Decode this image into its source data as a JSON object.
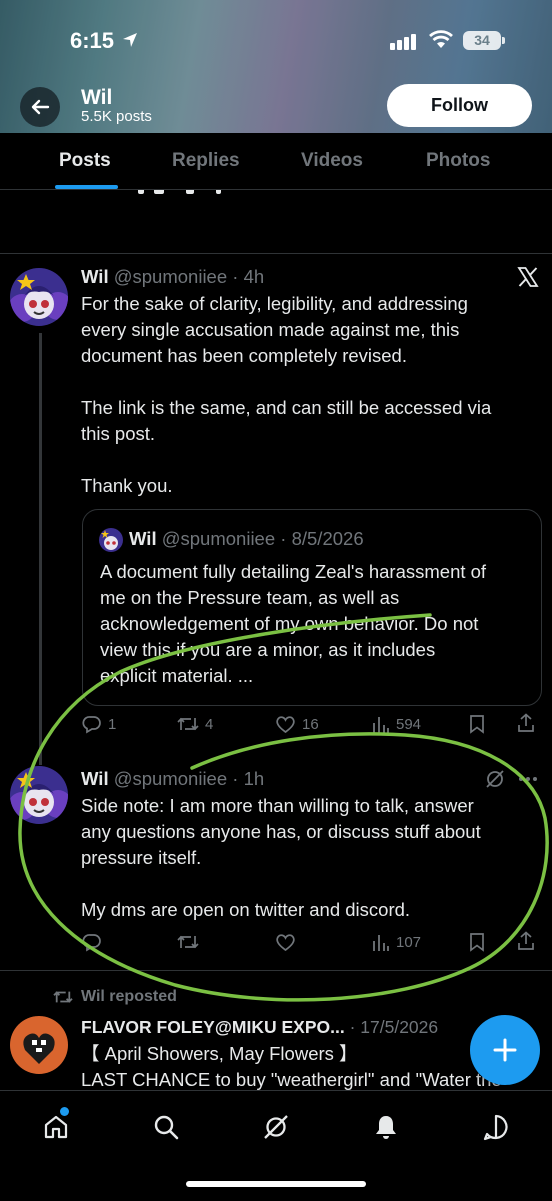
{
  "status_bar": {
    "time": "6:15",
    "battery": "34"
  },
  "profile": {
    "name": "Wil",
    "posts_count": "5.5K posts",
    "follow_label": "Follow"
  },
  "tabs": [
    {
      "label": "Posts",
      "active": true
    },
    {
      "label": "Replies"
    },
    {
      "label": "Videos"
    },
    {
      "label": "Photos"
    }
  ],
  "post1": {
    "name": "Wil",
    "handle": "@spumoniiee",
    "time": "4h",
    "lines": [
      "For the sake of clarity, legibility, and addressing",
      "every single accusation made against me, this",
      "document has been completely revised.",
      "The link is the same, and can still be accessed via",
      "this post.",
      "Thank you."
    ],
    "quote": {
      "name": "Wil",
      "handle": "@spumoniiee",
      "date": "8/5/2026",
      "lines": [
        "A document fully detailing Zeal's harassment of",
        "me on the Pressure team, as well as",
        "acknowledgement of my own behavior. Do not",
        "view this if you are a minor, as it includes",
        "explicit material. ..."
      ]
    },
    "actions": {
      "replies": "1",
      "reposts": "4",
      "likes": "16",
      "views": "594"
    }
  },
  "post2": {
    "name": "Wil",
    "handle": "@spumoniiee",
    "time": "1h",
    "lines": [
      "Side note: I am more than willing to talk, answer",
      "any questions anyone has, or discuss stuff about",
      "pressure itself.",
      "My dms are open on twitter and discord."
    ],
    "actions": {
      "views": "107"
    }
  },
  "post3": {
    "repost_label": "Wil reposted",
    "name": "FLAVOR FOLEY@MIKU EXPO...",
    "date": "17/5/2026",
    "lines": [
      "【 April Showers, May Flowers 】",
      "LAST CHANCE to buy \"weathergirl\" and \"Water the"
    ]
  },
  "colors": {
    "accent": "#1d9bf0",
    "annotation": "#7bc043",
    "background": "#000000"
  }
}
